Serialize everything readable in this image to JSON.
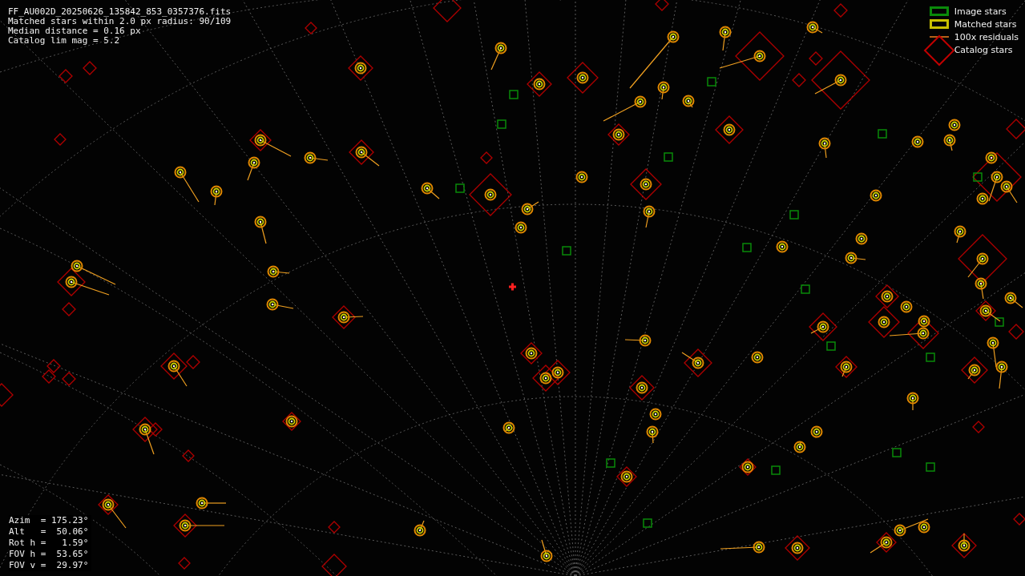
{
  "info_lines": [
    "FF_AU002D_20250626_135842_853_0357376.fits",
    "Matched stars within 2.0 px radius: 90/109",
    "Median distance = 0.16 px",
    "Catalog lim mag = 5.2"
  ],
  "legend": [
    {
      "kind": "image",
      "label": "Image stars"
    },
    {
      "kind": "matched",
      "label": "Matched stars"
    },
    {
      "kind": "residual",
      "label": "100x residuals"
    },
    {
      "kind": "catalog",
      "label": "Catalog stars"
    }
  ],
  "pointing": [
    "Azim  = 175.23°",
    "Alt   =  50.06°",
    "Rot h =   1.59°",
    "FOV h =  53.65°",
    "FOV v =  29.97°"
  ]
}
